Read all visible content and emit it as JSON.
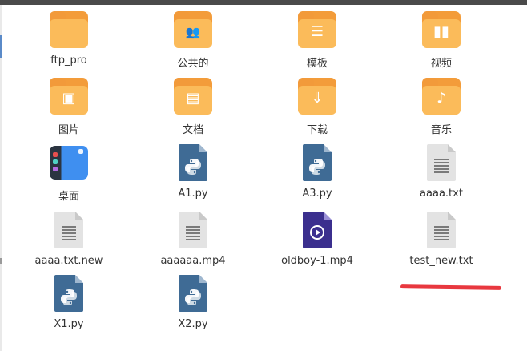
{
  "items": [
    {
      "label": "ftp_pro",
      "icon": "folder-icon"
    },
    {
      "label": "公共的",
      "icon": "folder-public-icon"
    },
    {
      "label": "模板",
      "icon": "folder-templates-icon"
    },
    {
      "label": "视频",
      "icon": "folder-videos-icon"
    },
    {
      "label": "图片",
      "icon": "folder-pictures-icon"
    },
    {
      "label": "文档",
      "icon": "folder-documents-icon"
    },
    {
      "label": "下载",
      "icon": "folder-download-icon"
    },
    {
      "label": "音乐",
      "icon": "folder-music-icon"
    },
    {
      "label": "桌面",
      "icon": "desktop-icon"
    },
    {
      "label": "A1.py",
      "icon": "python-file-icon"
    },
    {
      "label": "A3.py",
      "icon": "python-file-icon"
    },
    {
      "label": "aaaa.txt",
      "icon": "text-file-icon"
    },
    {
      "label": "aaaa.txt.new",
      "icon": "text-file-icon"
    },
    {
      "label": "aaaaaa.mp4",
      "icon": "text-file-icon"
    },
    {
      "label": "oldboy-1.mp4",
      "icon": "video-file-icon"
    },
    {
      "label": "test_new.txt",
      "icon": "text-file-icon"
    },
    {
      "label": "X1.py",
      "icon": "python-file-icon"
    },
    {
      "label": "X2.py",
      "icon": "python-file-icon"
    }
  ],
  "colors": {
    "folder": "#fbbb5a",
    "python": "#3f6b95",
    "video": "#3b2f8e",
    "annotation": "#e8383f"
  }
}
